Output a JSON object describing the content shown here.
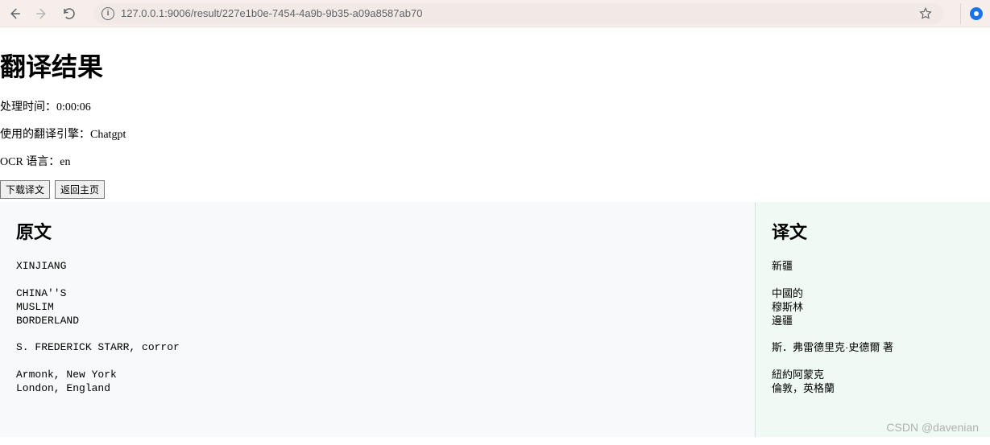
{
  "browser": {
    "url": "127.0.0.1:9006/result/227e1b0e-7454-4a9b-9b35-a09a8587ab70"
  },
  "page": {
    "title": "翻译结果",
    "meta": {
      "process_time_label": "处理时间：",
      "process_time_value": "0:00:06",
      "engine_label": "使用的翻译引擎：",
      "engine_value": "Chatgpt",
      "ocr_lang_label": "OCR 语言：",
      "ocr_lang_value": "en"
    },
    "buttons": {
      "download": "下载译文",
      "home": "返回主页"
    },
    "panels": {
      "original": {
        "heading": "原文",
        "text": "XINJIANG\n\nCHINA''S\nMUSLIM\nBORDERLAND\n\nS. FREDERICK STARR, corror\n\nArmonk, New York\nLondon, England"
      },
      "translation": {
        "heading": "译文",
        "text": "新疆\n\n中國的\n穆斯林\n邊疆\n\n斯．弗雷德里克·史德爾 著\n\n紐約阿蒙克\n倫敦，英格蘭"
      }
    }
  },
  "watermark": "CSDN @davenian"
}
